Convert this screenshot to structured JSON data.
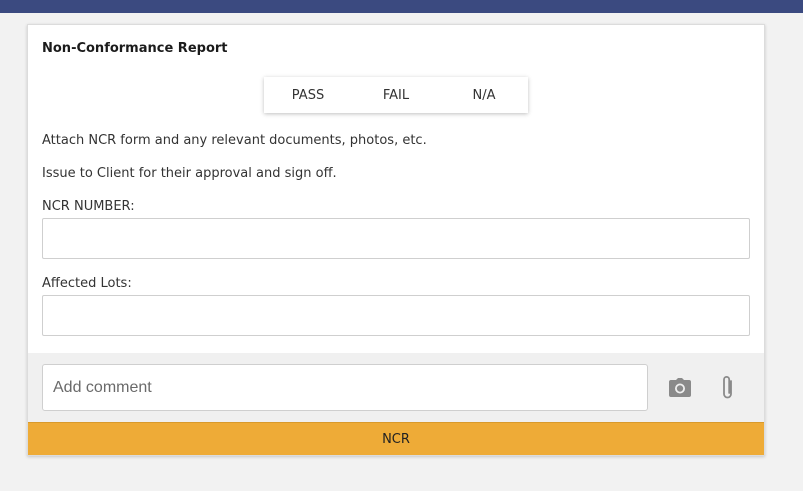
{
  "report": {
    "title": "Non-Conformance Report",
    "options": [
      "PASS",
      "FAIL",
      "N/A"
    ],
    "instructions": [
      "Attach NCR form and any relevant documents, photos, etc.",
      "Issue to Client for their approval and sign off."
    ],
    "fields": {
      "ncr_number": {
        "label": "NCR NUMBER:",
        "value": ""
      },
      "affected_lots": {
        "label": "Affected Lots:",
        "value": ""
      }
    }
  },
  "comment": {
    "placeholder": "Add comment",
    "icons": [
      "camera-icon",
      "paperclip-icon"
    ]
  },
  "action": {
    "label": "NCR"
  },
  "colors": {
    "topbar": "#3b4a80",
    "action_bg": "#eeab37",
    "icon_gray": "#8a8a8a"
  }
}
